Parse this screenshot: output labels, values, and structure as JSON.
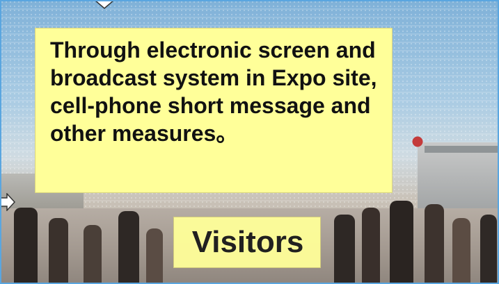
{
  "slide": {
    "message_text": "Through electronic screen and broadcast system in Expo site, cell-phone short message and other measures。",
    "visitors_label": "Visitors"
  },
  "icons": [
    "arrow-right-outline-icon",
    "arrow-down-outline-icon"
  ],
  "colors": {
    "callout_fill": "#ffff99",
    "frame_blue": "#5aa6e0",
    "text": "#111111"
  }
}
